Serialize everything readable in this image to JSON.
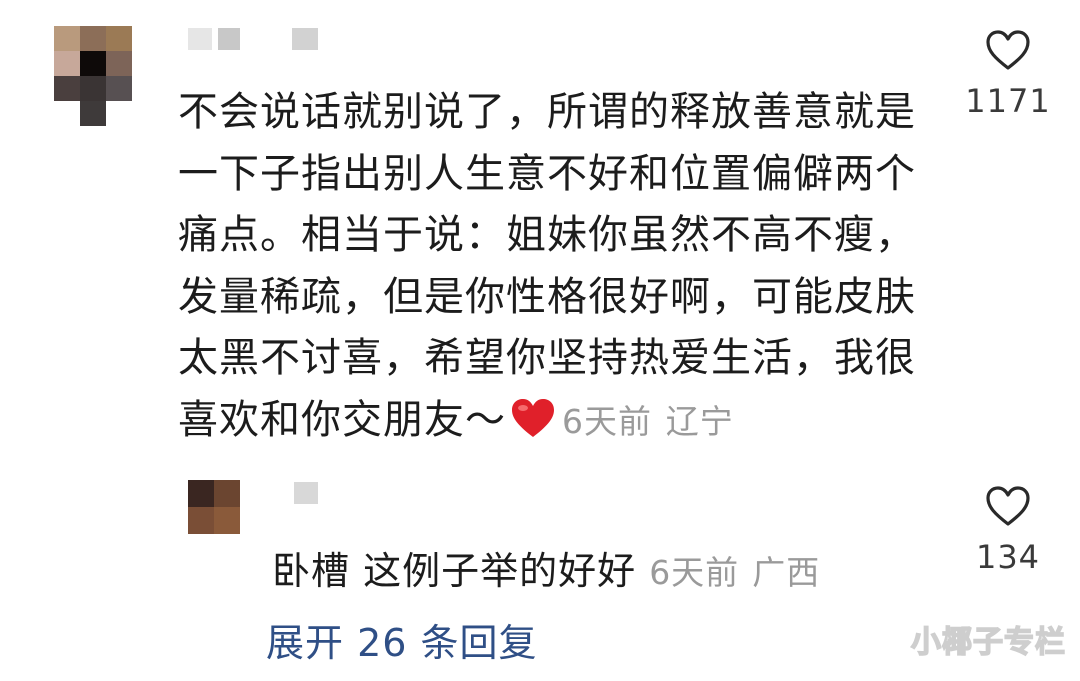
{
  "comment": {
    "text": "不会说话就别说了，所谓的释放善意就是一下子指出别人生意不好和位置偏僻两个痛点。相当于说：姐妹你虽然不高不瘦，发量稀疏，但是你性格很好啊，可能皮肤太黑不讨喜，希望你坚持热爱生活，我很喜欢和你交朋友～",
    "emoji": "heart-emoji",
    "time": "6天前",
    "location": "辽宁",
    "like_count": "1171"
  },
  "reply": {
    "text": "卧槽 这例子举的好好",
    "time": "6天前",
    "location": "广西",
    "like_count": "134"
  },
  "expand_replies": "展开 26 条回复",
  "watermark": "小椰子专栏",
  "colors": {
    "link": "#2f4f86",
    "meta": "#9a9a9a",
    "heart": "#e0202a"
  }
}
